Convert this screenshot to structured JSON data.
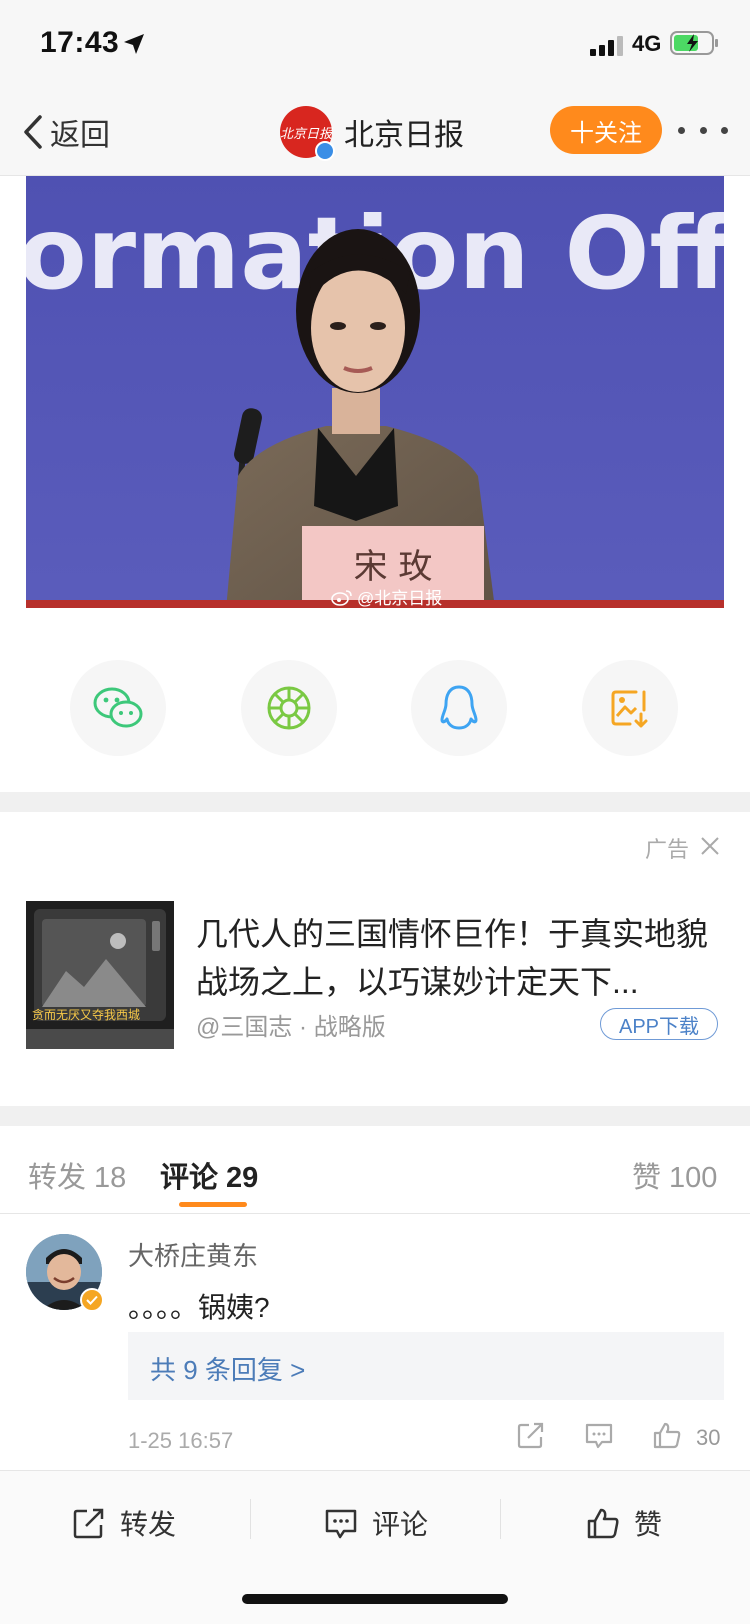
{
  "status_bar": {
    "time": "17:43",
    "network": "4G"
  },
  "nav": {
    "back_label": "返回",
    "avatar_text": "北京日报",
    "title": "北京日报",
    "follow_label": "十关注"
  },
  "photo": {
    "backdrop_text": "ormation Off",
    "nameplate": "宋 玫",
    "caption": "@北京日报"
  },
  "share": {
    "items": [
      {
        "icon": "wechat-icon",
        "color": "#3dc87a"
      },
      {
        "icon": "moments-icon",
        "color": "#7ac943"
      },
      {
        "icon": "qq-icon",
        "color": "#3ea4f2"
      },
      {
        "icon": "save-image-icon",
        "color": "#f5a623"
      }
    ]
  },
  "ad": {
    "tag": "广告",
    "thumb_text": "贪而无厌又夺我西城",
    "title": "几代人的三国情怀巨作！于真实地貌战场之上，以巧谋妙计定天下...",
    "source": "@三国志 · 战略版",
    "download_label": "APP下载"
  },
  "tabs": {
    "repost": {
      "label": "转发",
      "count": "18"
    },
    "comment": {
      "label": "评论",
      "count": "29"
    },
    "like": {
      "label": "赞",
      "count": "100"
    }
  },
  "comment": {
    "author": "大桥庄黄东",
    "text": "。。。。锅姨?",
    "replies_label": "共 9 条回复 >",
    "time": "1-25 16:57",
    "like_count": "30"
  },
  "bottom_bar": {
    "repost_label": "转发",
    "comment_label": "评论",
    "like_label": "赞"
  },
  "colors": {
    "accent": "#ff8a1c",
    "link": "#4c7cb8",
    "photo_backdrop": "#5556b4"
  }
}
